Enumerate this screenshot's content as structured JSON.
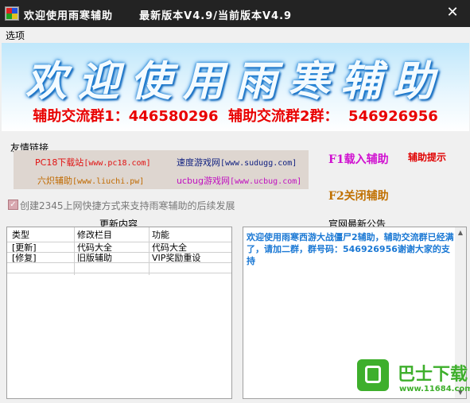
{
  "window": {
    "title": "欢迎使用雨寒辅助      最新版本V4.9/当前版本V4.9",
    "close_glyph": "✕"
  },
  "menu": {
    "options_label": "选项"
  },
  "banner": {
    "title": "欢迎使用雨寒辅助",
    "groups_text": "辅助交流群1：446580296  辅助交流群2群：  546926956"
  },
  "links": {
    "section_label": "友情链接",
    "items": [
      {
        "name": "PC18下载站",
        "url": "[www.pc18.com]",
        "color": "#e01010"
      },
      {
        "name": "速度游戏网",
        "url": "[www.sudugg.com]",
        "color": "#102080"
      },
      {
        "name": "六炽辅助",
        "url": "[www.liuchi.pw]",
        "color": "#c06a00"
      },
      {
        "name": "ucbug游戏网",
        "url": "[www.ucbug.com]",
        "color": "#c010c0"
      }
    ]
  },
  "hotkeys": {
    "load": "F1载入辅助",
    "close": "F2关闭辅助",
    "tip": "辅助提示"
  },
  "shortcut_option": {
    "checked": true,
    "label": "创建2345上网快捷方式来支持雨寒辅助的后续发展"
  },
  "updates": {
    "title": "更新内容",
    "columns": [
      "类型",
      "修改栏目",
      "功能"
    ],
    "rows": [
      [
        "[更新]",
        "代码大全",
        "代码大全"
      ],
      [
        "[修复]",
        "旧版辅助",
        "VIP奖励重设"
      ]
    ]
  },
  "announcement": {
    "title": "官网最新公告",
    "text": "欢迎使用雨寒西游大战僵尸2辅助，辅助交流群已经满了，请加二群，群号码：546926956谢谢大家的支持"
  },
  "watermark": {
    "name": "巴士下载",
    "url": "www.11684.com"
  }
}
